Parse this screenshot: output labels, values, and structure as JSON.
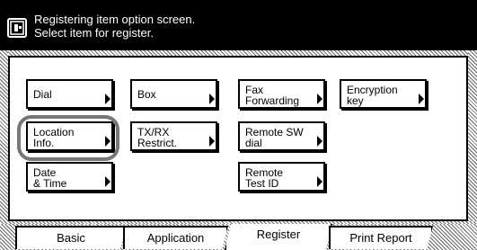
{
  "header": {
    "line1": "Registering item option screen.",
    "line2": "Select item for register.",
    "icon": "panel-icon"
  },
  "buttons": {
    "dial": "Dial",
    "box": "Box",
    "fax_forwarding": "Fax\nForwarding",
    "encryption_key": "Encryption\nkey",
    "location_info": "Location\nInfo.",
    "txrx_restrict": "TX/RX\nRestrict.",
    "remote_sw_dial": "Remote SW\ndial",
    "date_time": "Date\n& Time",
    "remote_test_id": "Remote\nTest ID"
  },
  "tabs": {
    "basic": "Basic",
    "application": "Application",
    "register": "Register",
    "print_report": "Print Report"
  },
  "colors": {
    "header_bg": "#000000",
    "highlight_ring": "#777777"
  }
}
